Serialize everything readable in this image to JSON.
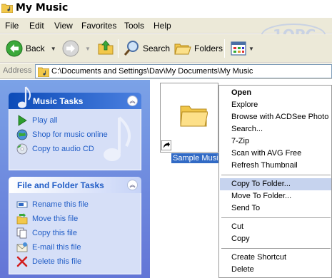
{
  "window": {
    "title": "My Music"
  },
  "menu": [
    "File",
    "Edit",
    "View",
    "Favorites",
    "Tools",
    "Help"
  ],
  "toolbar": {
    "back_label": "Back",
    "search_label": "Search",
    "folders_label": "Folders"
  },
  "address": {
    "label": "Address",
    "path": "C:\\Documents and Settings\\Dav\\My Documents\\My Music"
  },
  "music_tasks": {
    "title": "Music Tasks",
    "items": [
      "Play all",
      "Shop for music online",
      "Copy to audio CD"
    ]
  },
  "file_tasks": {
    "title": "File and Folder Tasks",
    "items": [
      "Rename this file",
      "Move this file",
      "Copy this file",
      "E-mail this file",
      "Delete this file"
    ]
  },
  "selected_item": {
    "label": "Sample Music"
  },
  "context_menu": {
    "items": [
      "Open",
      "Explore",
      "Browse with ACDSee Photo M",
      "Search...",
      "7-Zip",
      "Scan with AVG Free",
      "Refresh Thumbnail",
      "Copy To Folder...",
      "Move To Folder...",
      "Send To",
      "Cut",
      "Copy",
      "Create Shortcut",
      "Delete"
    ],
    "highlighted": "Copy To Folder..."
  },
  "colors": {
    "taskpane_gradient_top": "#7ba2e7",
    "taskpane_gradient_bottom": "#6375d6",
    "link_blue": "#215dc6",
    "selection_blue": "#316ac5"
  }
}
